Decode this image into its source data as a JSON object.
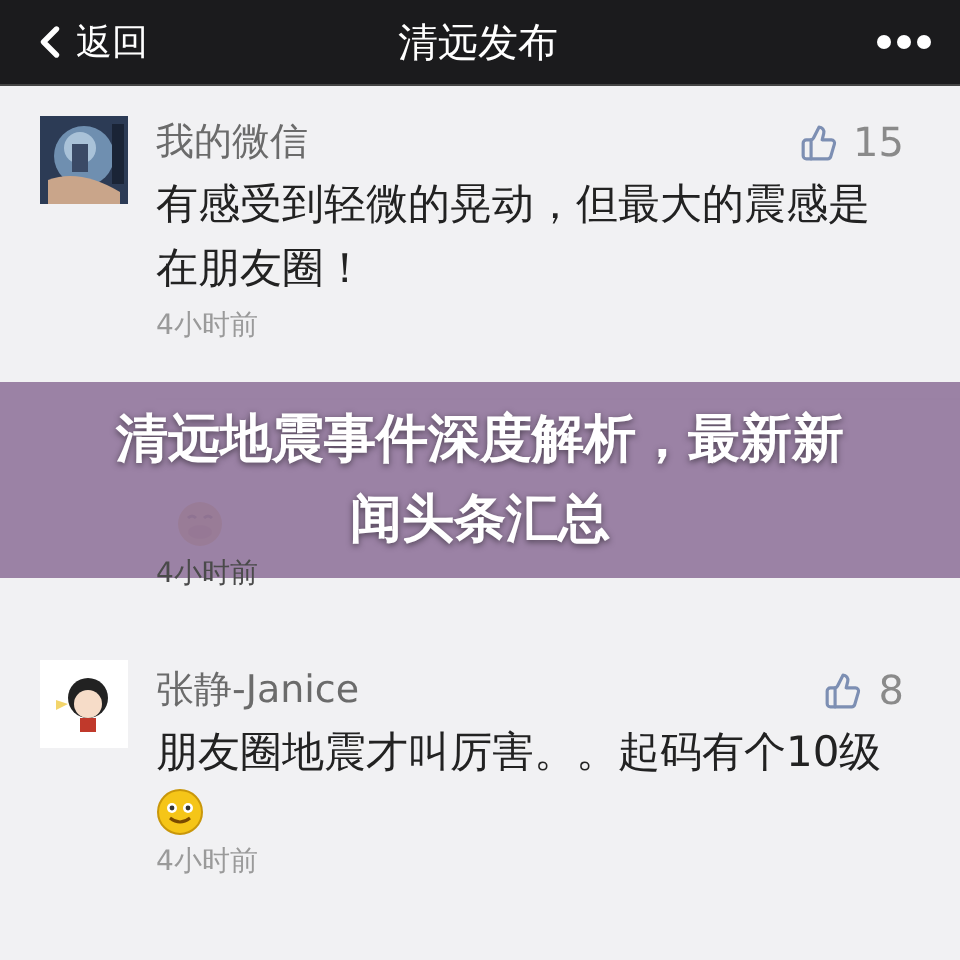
{
  "header": {
    "back_label": "返回",
    "title": "清远发布"
  },
  "comments": [
    {
      "name": "我的微信",
      "likes": "15",
      "text": "有感受到轻微的晃动，但最大的震感是在朋友圈！",
      "emoji": false,
      "time": "4小时前"
    },
    {
      "emoji": true,
      "time": "4小时前"
    },
    {
      "name": "张静-Janice",
      "likes": "8",
      "text": "朋友圈地震才叫厉害。。起码有个10级",
      "emoji": true,
      "time": "4小时前"
    }
  ],
  "banner": {
    "title": "清远地震事件深度解析，最新新闻头条汇总"
  }
}
